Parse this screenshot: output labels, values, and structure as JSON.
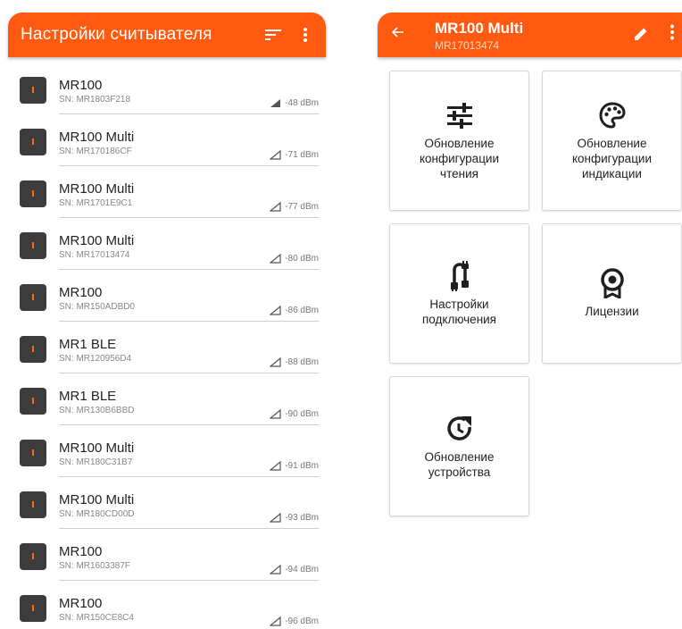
{
  "left_panel": {
    "title": "Настройки считывателя",
    "accent_color": "#ff5a0f",
    "readers": [
      {
        "name": "MR100",
        "sn": "SN: MR1803F218",
        "rssi": "-48 dBm",
        "signal_filled": true
      },
      {
        "name": "MR100 Multi",
        "sn": "SN: MR170186CF",
        "rssi": "-71 dBm",
        "signal_filled": false
      },
      {
        "name": "MR100 Multi",
        "sn": "SN: MR1701E9C1",
        "rssi": "-77 dBm",
        "signal_filled": false
      },
      {
        "name": "MR100 Multi",
        "sn": "SN: MR17013474",
        "rssi": "-80 dBm",
        "signal_filled": false
      },
      {
        "name": "MR100",
        "sn": "SN: MR150ADBD0",
        "rssi": "-86 dBm",
        "signal_filled": false
      },
      {
        "name": "MR1 BLE",
        "sn": "SN: MR120956D4",
        "rssi": "-88 dBm",
        "signal_filled": false
      },
      {
        "name": "MR1 BLE",
        "sn": "SN: MR130B6BBD",
        "rssi": "-90 dBm",
        "signal_filled": false
      },
      {
        "name": "MR100 Multi",
        "sn": "SN: MR180C31B7",
        "rssi": "-91 dBm",
        "signal_filled": false
      },
      {
        "name": "MR100 Multi",
        "sn": "SN: MR180CD00D",
        "rssi": "-93 dBm",
        "signal_filled": false
      },
      {
        "name": "MR100",
        "sn": "SN: MR1603387F",
        "rssi": "-94 dBm",
        "signal_filled": false
      },
      {
        "name": "MR100",
        "sn": "SN: MR150CE8C4",
        "rssi": "-96 dBm",
        "signal_filled": false
      }
    ]
  },
  "right_panel": {
    "title": "MR100 Multi",
    "subtitle": "MR17013474",
    "tiles": [
      {
        "label": "Обновление\nконфигурации\nчтения",
        "icon": "tune-icon"
      },
      {
        "label": "Обновление\nконфигурации\nиндикации",
        "icon": "palette-icon"
      },
      {
        "label": "Настройки\nподключения",
        "icon": "cable-icon"
      },
      {
        "label": "Лицензии",
        "icon": "license-badge-icon"
      },
      {
        "label": "Обновление\nустройства",
        "icon": "update-icon"
      }
    ]
  }
}
